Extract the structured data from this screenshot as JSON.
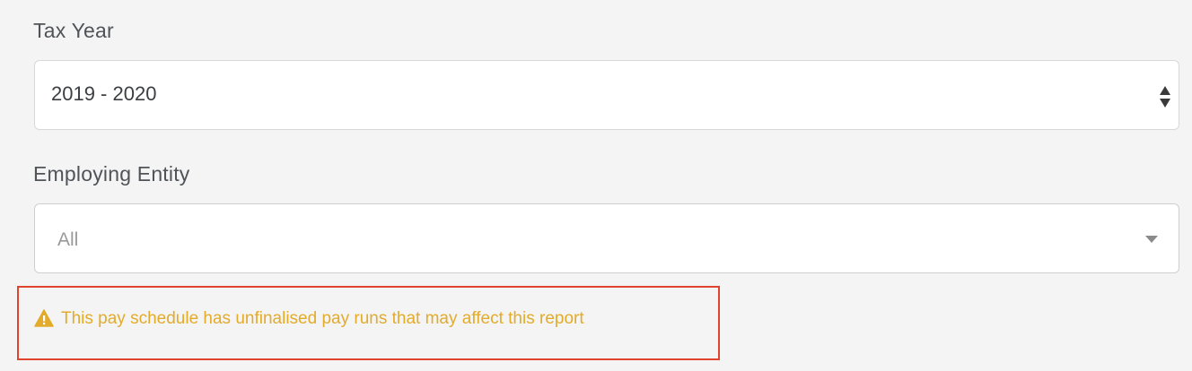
{
  "tax_year": {
    "label": "Tax Year",
    "selected_value": "2019 - 2020",
    "icon": "sort-updown-icon"
  },
  "employing_entity": {
    "label": "Employing Entity",
    "placeholder": "All",
    "icon": "caret-down-icon"
  },
  "warning": {
    "icon": "warning-triangle-icon",
    "text": "This pay schedule has unfinalised pay runs that may affect this report",
    "text_color": "#e3ab2a",
    "highlight_border_color": "#e0432e"
  }
}
